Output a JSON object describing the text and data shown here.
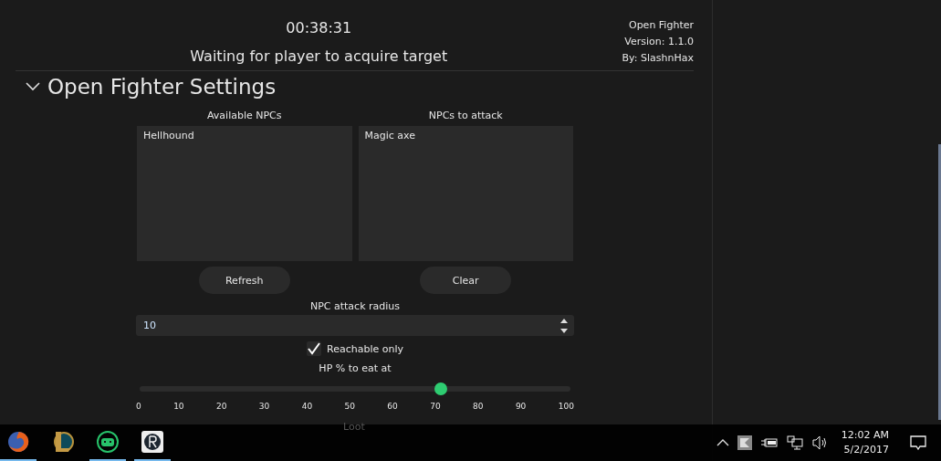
{
  "header": {
    "timer": "00:38:31",
    "status": "Waiting for player to acquire target",
    "info": [
      "Open Fighter",
      "Version: 1.1.0",
      "By: SlashnHax"
    ]
  },
  "section": {
    "title": "Open Fighter Settings",
    "expanded": true
  },
  "lists": [
    {
      "label": "Available NPCs",
      "items": [
        "Hellhound"
      ],
      "button": "Refresh"
    },
    {
      "label": "NPCs to attack",
      "items": [
        "Magic axe"
      ],
      "button": "Clear"
    }
  ],
  "radius": {
    "label": "NPC attack radius",
    "value": "10"
  },
  "reachable": {
    "label": "Reachable only",
    "checked": true
  },
  "hp_slider": {
    "label": "HP % to eat at",
    "level": 0.7,
    "ticks": [
      "0",
      "10",
      "20",
      "30",
      "40",
      "50",
      "60",
      "70",
      "80",
      "90",
      "100"
    ]
  },
  "next_section": "Loot",
  "taskbar": {
    "apps": [
      {
        "kind": "firefox",
        "active": true
      },
      {
        "kind": "league",
        "active": false
      },
      {
        "kind": "robot",
        "active": true
      },
      {
        "kind": "rlogo",
        "active": true
      }
    ],
    "time": "12:02 AM",
    "date": "5/2/2017"
  }
}
